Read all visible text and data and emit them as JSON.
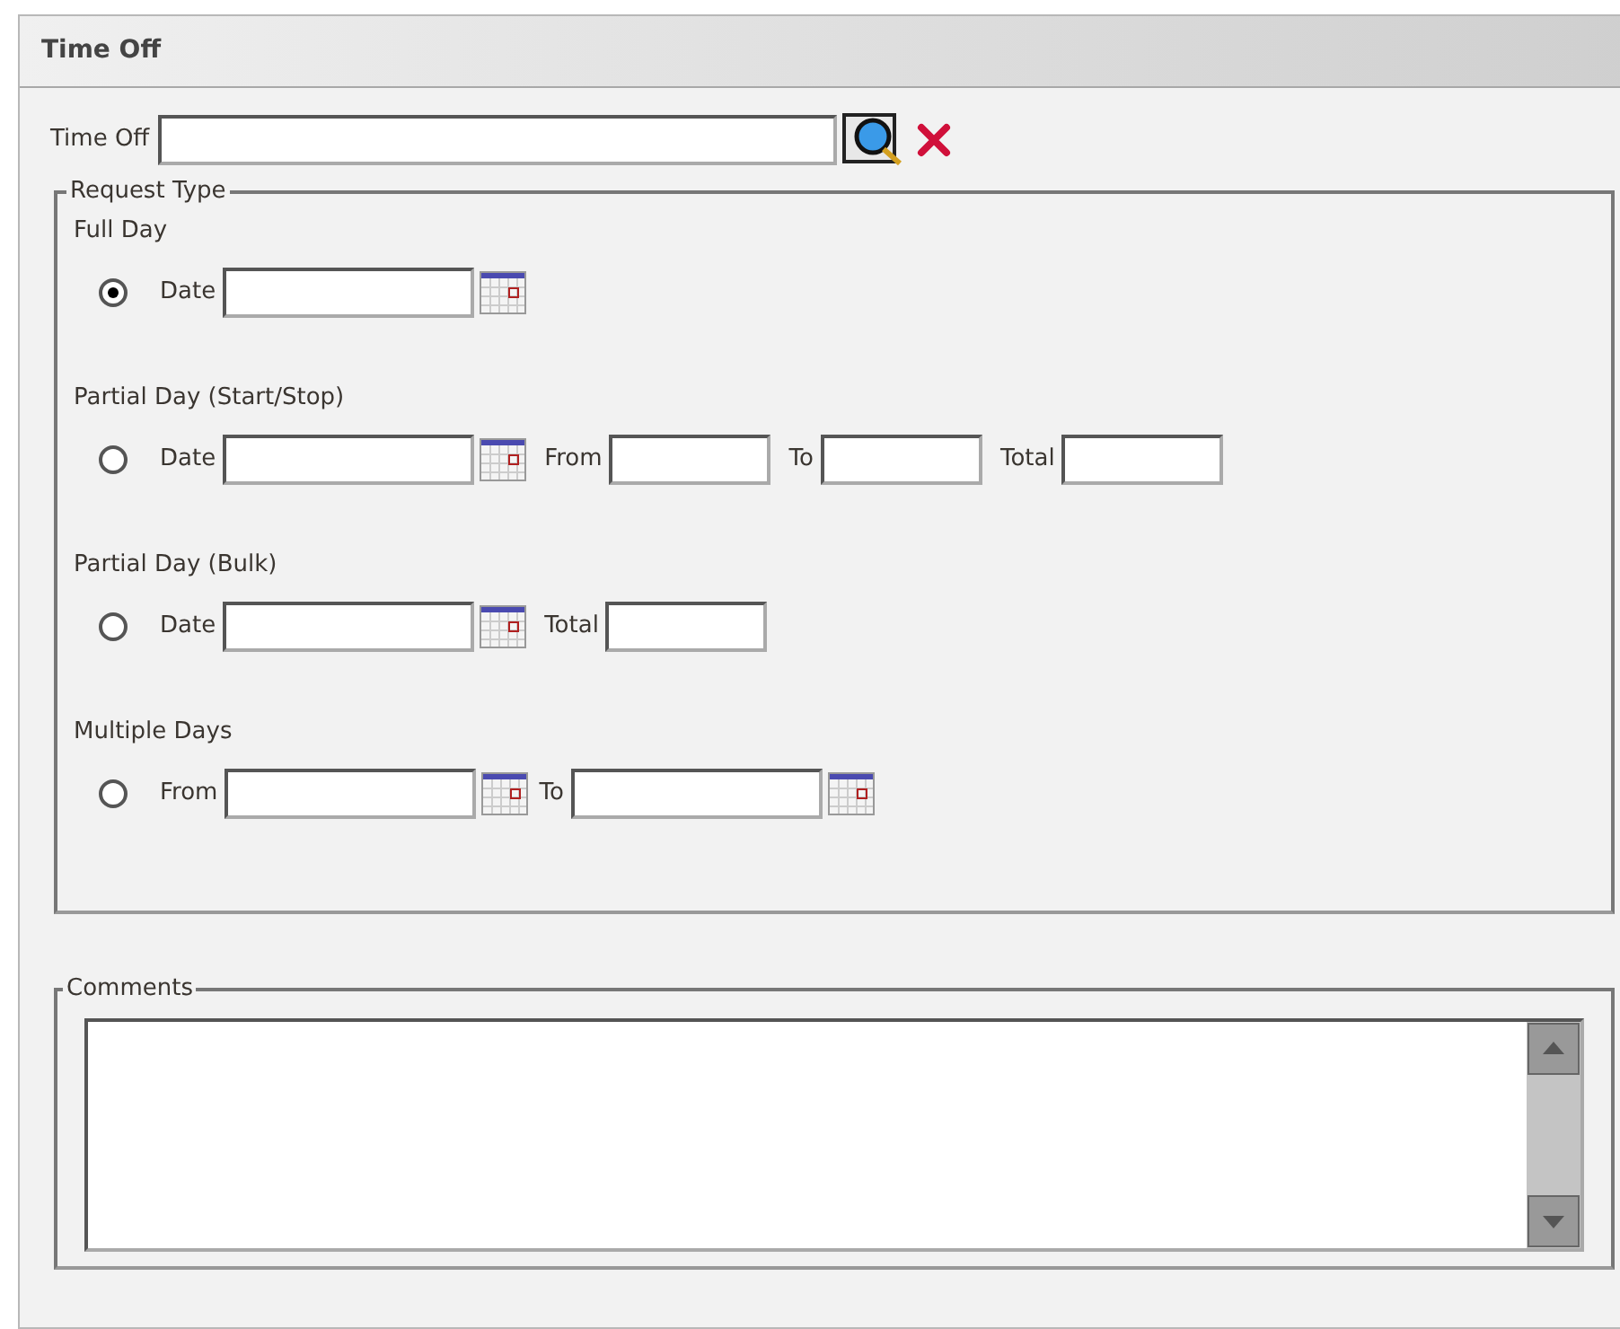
{
  "panel": {
    "title": "Time Off"
  },
  "lookup": {
    "label": "Time Off"
  },
  "request_type": {
    "legend": "Request Type",
    "options": [
      {
        "heading": "Full Day",
        "selected": true,
        "fields": [
          {
            "kind": "date",
            "label": "Date"
          }
        ]
      },
      {
        "heading": "Partial Day (Start/Stop)",
        "selected": false,
        "fields": [
          {
            "kind": "date",
            "label": "Date"
          },
          {
            "kind": "text",
            "label": "From"
          },
          {
            "kind": "text",
            "label": "To"
          },
          {
            "kind": "text",
            "label": "Total"
          }
        ]
      },
      {
        "heading": "Partial Day (Bulk)",
        "selected": false,
        "fields": [
          {
            "kind": "date",
            "label": "Date"
          },
          {
            "kind": "text",
            "label": "Total"
          }
        ]
      },
      {
        "heading": "Multiple Days",
        "selected": false,
        "fields": [
          {
            "kind": "date",
            "label": "From"
          },
          {
            "kind": "date",
            "label": "To"
          }
        ]
      }
    ]
  },
  "comments": {
    "legend": "Comments"
  }
}
